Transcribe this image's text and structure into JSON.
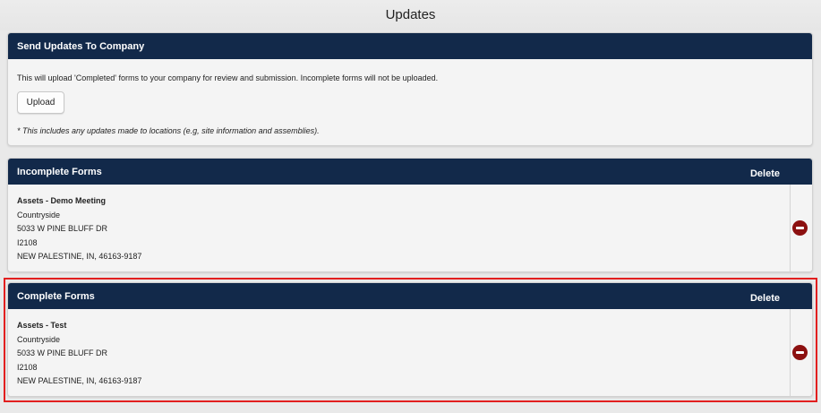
{
  "page": {
    "title": "Updates"
  },
  "send_panel": {
    "title": "Send Updates To Company",
    "description": "This will upload 'Completed' forms to your company for review and submission. Incomplete forms will not be uploaded.",
    "upload_label": "Upload",
    "note": "* This includes any updates made to locations (e.g, site information and assemblies)."
  },
  "incomplete_panel": {
    "title": "Incomplete Forms",
    "delete_label": "Delete",
    "item": {
      "name": "Assets - Demo Meeting",
      "line1": "Countryside",
      "line2": "5033 W PINE BLUFF DR",
      "line3": "I2108",
      "line4": "NEW PALESTINE, IN, 46163-9187"
    }
  },
  "complete_panel": {
    "title": "Complete Forms",
    "delete_label": "Delete",
    "item": {
      "name": "Assets - Test",
      "line1": "Countryside",
      "line2": "5033 W PINE BLUFF DR",
      "line3": "I2108",
      "line4": "NEW PALESTINE, IN, 46163-9187"
    }
  },
  "colors": {
    "header_bg": "#12294a",
    "delete_icon": "#8c1010",
    "highlight": "#e21f1f"
  },
  "icons": {
    "delete": "minus-circle-icon"
  }
}
